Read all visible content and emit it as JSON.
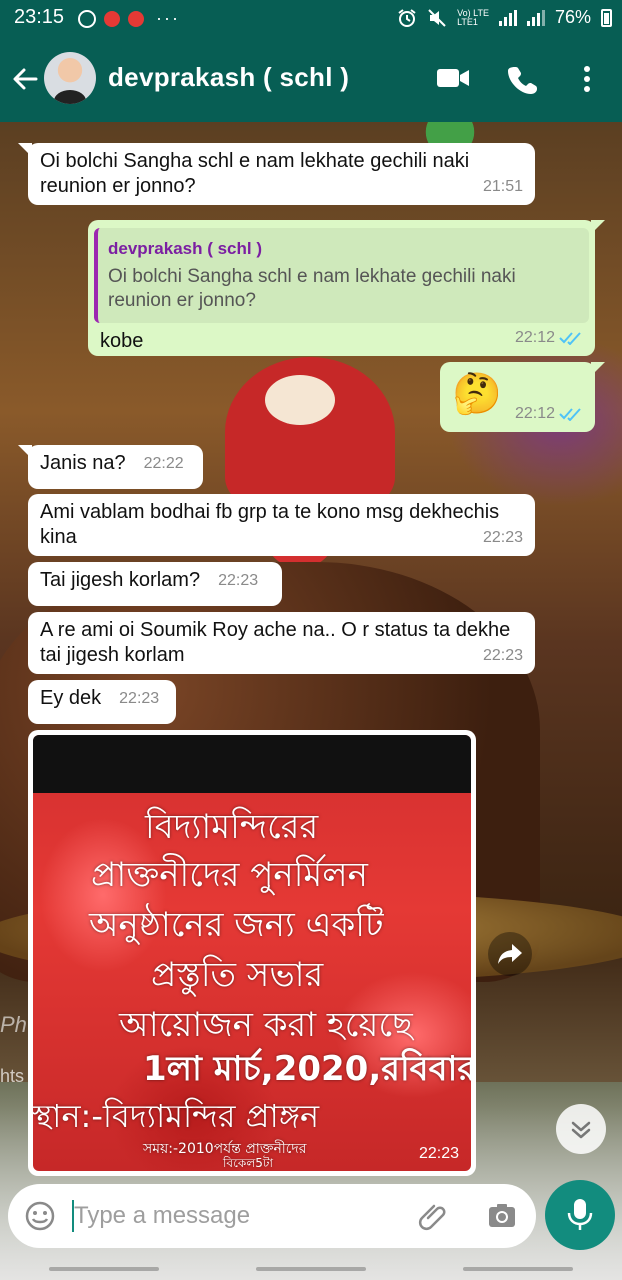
{
  "status_bar": {
    "time": "23:15",
    "dots": "···",
    "volte": "Vo)",
    "lte": "LTE",
    "lte1": "LTE1",
    "battery": "76%"
  },
  "header": {
    "contact_name": "devprakash ( schl )",
    "back_icon": "arrow-left",
    "video_icon": "video-camera",
    "phone_icon": "phone",
    "menu_icon": "more-vertical"
  },
  "messages": [
    {
      "direction": "in",
      "text": "Oi bolchi Sangha schl e nam lekhate gechili naki reunion er jonno?",
      "time": "21:51"
    },
    {
      "direction": "out",
      "quote_author": "devprakash ( schl )",
      "quote_text": "Oi bolchi Sangha schl e nam lekhate gechili naki reunion er jonno?",
      "text": "kobe",
      "time": "22:12",
      "status": "read"
    },
    {
      "direction": "out",
      "text": "🤔",
      "time": "22:12",
      "status": "read"
    },
    {
      "direction": "in",
      "text": "Janis na?",
      "time": "22:22"
    },
    {
      "direction": "in",
      "text": "Ami vablam bodhai fb grp ta te kono msg dekhechis kina",
      "time": "22:23"
    },
    {
      "direction": "in",
      "text": "Tai jigesh korlam?",
      "time": "22:23"
    },
    {
      "direction": "in",
      "text": "A re ami oi Soumik Roy ache na.. O r status ta dekhe tai jigesh korlam",
      "time": "22:23"
    },
    {
      "direction": "in",
      "text": "Ey dek",
      "time": "22:23"
    }
  ],
  "image_message": {
    "lines": [
      "বিদ্যামন্দিরের",
      "প্রাক্তনীদের পুনর্মিলন",
      "অনুষ্ঠানের জন্য একটি",
      "প্রস্তুতি সভার",
      "আয়োজন করা হয়েছে",
      "1লা মার্চ,2020,রবিবার",
      "স্থান:-বিদ্যামন্দির প্রাঙ্গন",
      "সময়:-2010পর্যন্ত প্রাক্তনীদের",
      "বিকেল5টা"
    ],
    "time": "22:23"
  },
  "background_text": {
    "ph": "Ph",
    "ht": "hts"
  },
  "input": {
    "placeholder": "Type a message"
  },
  "colors": {
    "header": "#075e54",
    "out_bubble": "#dcf8c6",
    "in_bubble": "#ffffff",
    "read_ticks": "#4fc3f7",
    "mic_button": "#128c7e"
  }
}
